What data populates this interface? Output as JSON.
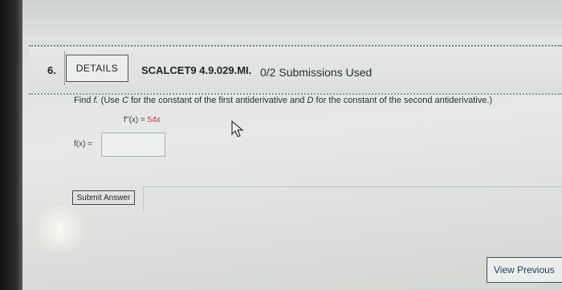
{
  "question": {
    "number": "6.",
    "details_label": "DETAILS",
    "code": "SCALCET9 4.9.029.MI.",
    "submissions": "0/2 Submissions Used"
  },
  "problem": {
    "find_prefix": "Find",
    "find_var": "f.",
    "paren_open": "(Use",
    "c_var": "C",
    "mid_text": "for the constant of the first antiderivative and",
    "d_var": "D",
    "end_text": "for the constant of the second antiderivative.)",
    "equation_lhs": "f''(x) = ",
    "equation_rhs": "54x",
    "answer_label": "f(x) =",
    "answer_value": ""
  },
  "actions": {
    "submit_label": "Submit Answer",
    "view_previous_label": "View Previous"
  }
}
